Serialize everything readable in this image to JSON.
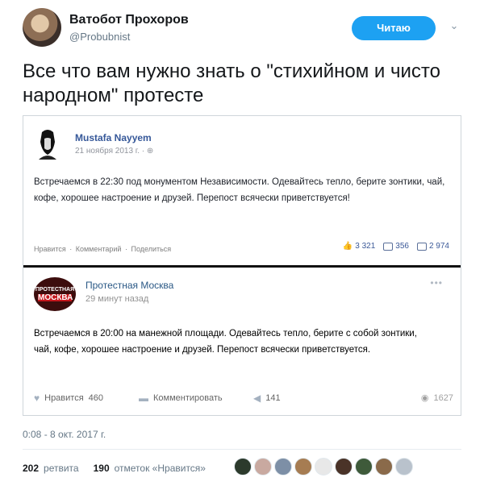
{
  "author": {
    "name": "Ватобот Прохоров",
    "handle": "@Probubnist",
    "follow_label": "Читаю"
  },
  "tweet": {
    "text": "Все что вам нужно знать о \"стихийном и чисто народном\" протесте",
    "timestamp": "0:08 - 8 окт. 2017 г."
  },
  "embedded_post_1": {
    "name": "Mustafa Nayyem",
    "date": "21 ноября 2013 г. · ⊕",
    "text": "Встречаемся в 22:30 под монументом Независимости. Одевайтесь тепло, берите зонтики, чай, кофе, хорошее настроение и друзей. Перепост всячески приветствуется!",
    "actions": [
      "Нравится",
      "·",
      "Комментарий",
      "·",
      "Поделиться"
    ],
    "likes": "3 321",
    "comments": "356",
    "shares": "2 974"
  },
  "embedded_post_2": {
    "name": "Протестная Москва",
    "time": "29 минут назад",
    "avatar_text_top": "ПРОТЕСТНАЯ",
    "avatar_text_bottom": "МОСКВА",
    "text": "Встречаемся в 20:00 на манежной площади. Одевайтесь тепло, берите с собой зонтики, чай, кофе, хорошее настроение и друзей. Перепост всячески приветствуется.",
    "like_label": "Нравится",
    "like_count": "460",
    "comment_label": "Комментировать",
    "share_count": "141",
    "views": "1627"
  },
  "stats": {
    "retweets_count": "202",
    "retweets_label": "ретвита",
    "likes_count": "190",
    "likes_label": "отметок «Нравится»"
  },
  "colors": {
    "follow_button": "#1da1f2",
    "fb_name": "#365899",
    "vk_name": "#2a5885"
  }
}
